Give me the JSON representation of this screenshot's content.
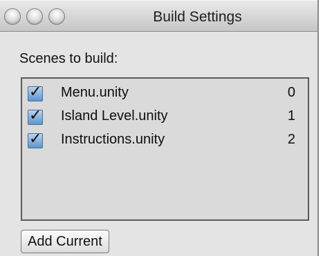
{
  "window": {
    "title": "Build Settings"
  },
  "scenes_section": {
    "label": "Scenes to build:",
    "scenes": [
      {
        "name": "Menu.unity",
        "index": "0",
        "checked": true
      },
      {
        "name": "Island Level.unity",
        "index": "1",
        "checked": true
      },
      {
        "name": "Instructions.unity",
        "index": "2",
        "checked": true
      }
    ]
  },
  "buttons": {
    "add_current": "Add Current"
  },
  "icons": {
    "window_controls": [
      "close-button-icon",
      "minimize-button-icon",
      "zoom-button-icon"
    ],
    "checkbox_mark": "✓"
  }
}
